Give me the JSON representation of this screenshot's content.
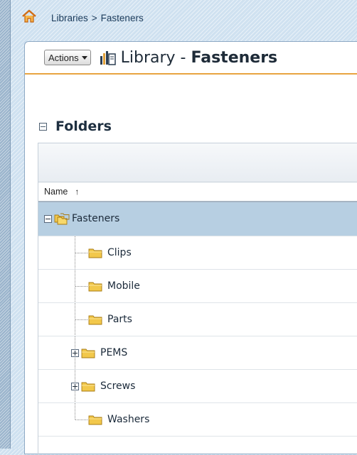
{
  "breadcrumb": {
    "root": "Libraries",
    "separator": ">",
    "current": "Fasteners"
  },
  "toolbar": {
    "actions_label": "Actions",
    "title_prefix": "Library - ",
    "title_name": "Fasteners"
  },
  "folders": {
    "section_label": "Folders",
    "column_name": "Name",
    "sort_indicator": "↑",
    "root": {
      "label": "Fasteners",
      "expanded": true,
      "selected": true
    },
    "items": [
      {
        "label": "Clips",
        "has_children": false
      },
      {
        "label": "Mobile",
        "has_children": false
      },
      {
        "label": "Parts",
        "has_children": false
      },
      {
        "label": "PEMS",
        "has_children": true
      },
      {
        "label": "Screws",
        "has_children": true
      },
      {
        "label": "Washers",
        "has_children": false
      }
    ]
  },
  "colors": {
    "accent_line": "#e8a440",
    "selected_row": "#b7cfe2",
    "folder": "#f2c84b"
  },
  "icons": {
    "home": "home-icon",
    "library": "library-icon",
    "folder": "folder-icon",
    "folder_group": "folder-group-icon"
  }
}
